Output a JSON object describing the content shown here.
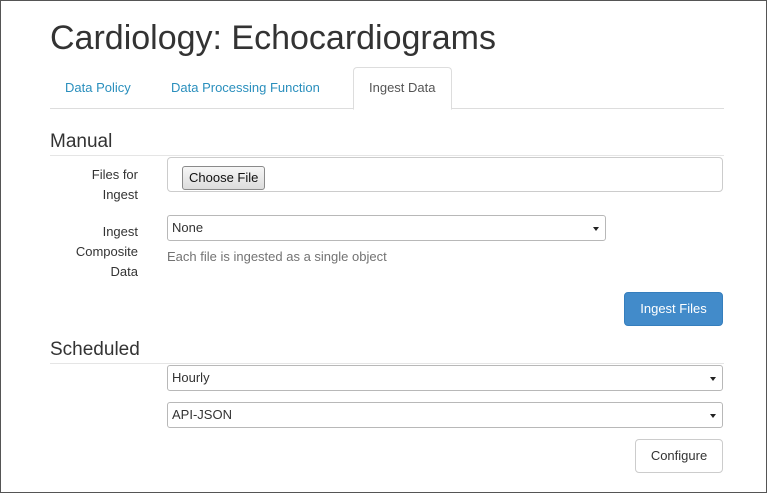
{
  "page": {
    "title": "Cardiology: Echocardiograms"
  },
  "tabs": [
    {
      "label": "Data Policy",
      "active": false
    },
    {
      "label": "Data Processing Function",
      "active": false
    },
    {
      "label": "Ingest Data",
      "active": true
    }
  ],
  "manual": {
    "heading": "Manual",
    "files_label_line1": "Files for",
    "files_label_line2": "Ingest",
    "choose_file_label": "Choose File",
    "composite_label_line1": "Ingest",
    "composite_label_line2": "Composite",
    "composite_label_line3": "Data",
    "composite_select_value": "None",
    "composite_help": "Each file is ingested as a single object",
    "ingest_button_label": "Ingest Files"
  },
  "scheduled": {
    "heading": "Scheduled",
    "frequency_select_value": "Hourly",
    "source_select_value": "API-JSON",
    "configure_button_label": "Configure"
  },
  "colors": {
    "link": "#2a8fbd",
    "primary_button": "#428bca",
    "text": "#333333",
    "help_text": "#737373"
  },
  "icons": {
    "dropdown": "caret-down"
  }
}
